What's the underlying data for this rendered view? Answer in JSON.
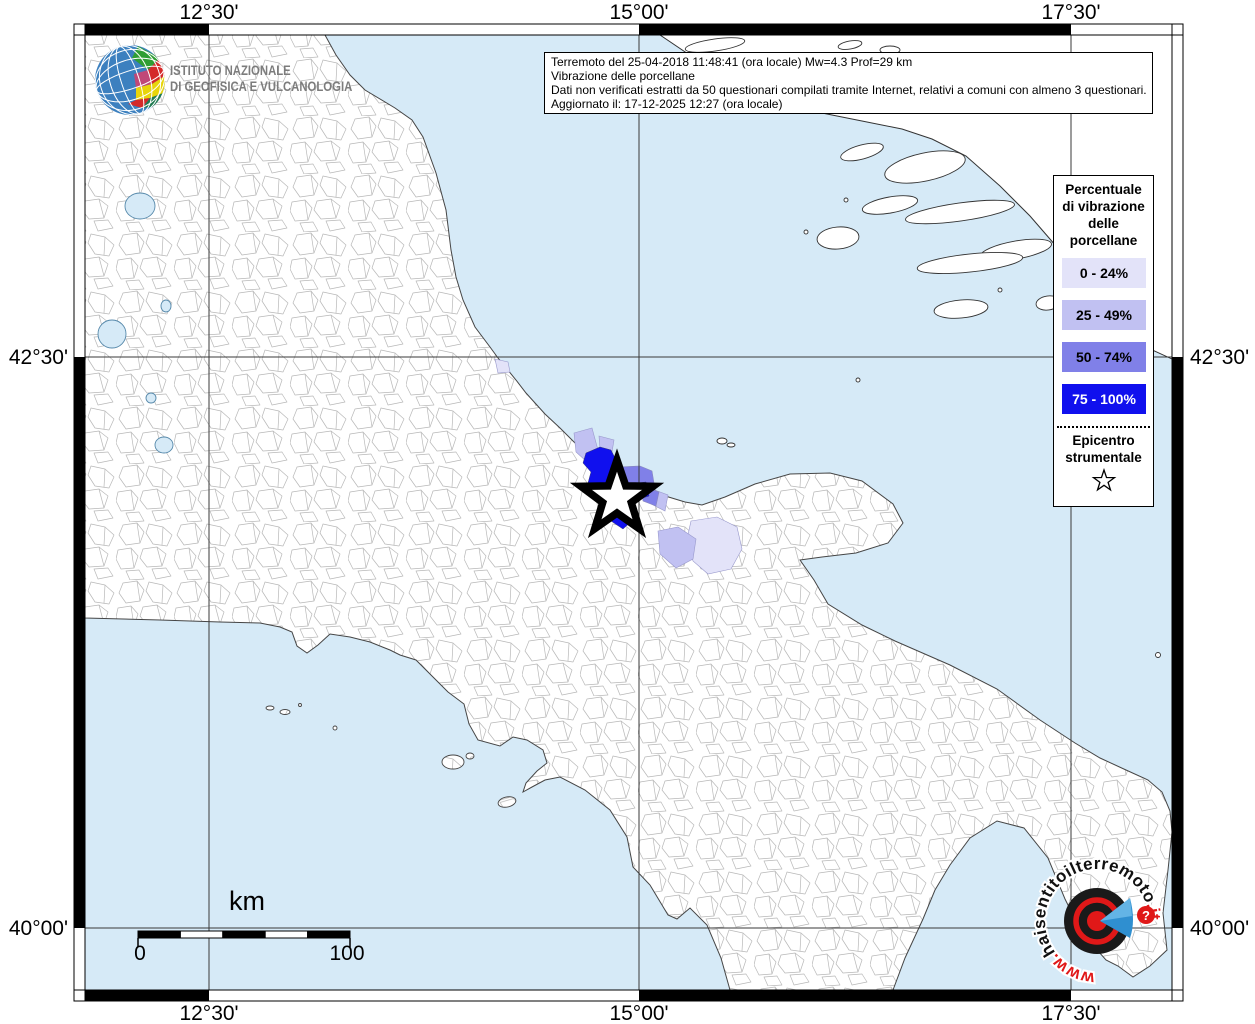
{
  "info_box": {
    "lines": [
      "Terremoto del 25-04-2018 11:48:41 (ora locale) Mw=4.3 Prof=29 km",
      "Vibrazione delle porcellane",
      "Dati non verificati estratti da 50 questionari compilati tramite Internet, relativi a comuni con almeno 3 questionari.",
      "Aggiornato il: 17-12-2025 12:27 (ora locale)"
    ]
  },
  "axis": {
    "top": [
      "12°30'",
      "15°00'",
      "17°30'"
    ],
    "bottom": [
      "12°30'",
      "15°00'",
      "17°30'"
    ],
    "left": [
      "42°30'",
      "40°00'"
    ],
    "right": [
      "42°30'",
      "40°00'"
    ]
  },
  "legend": {
    "title_lines": [
      "Percentuale",
      "di vibrazione",
      "delle",
      "porcellane"
    ],
    "classes": [
      {
        "label": "0 - 24%",
        "color": "#e3e3f9",
        "text_color": "#000000"
      },
      {
        "label": "25 - 49%",
        "color": "#c1c1f2",
        "text_color": "#000000"
      },
      {
        "label": "50 - 74%",
        "color": "#8080e8",
        "text_color": "#000000"
      },
      {
        "label": "75 - 100%",
        "color": "#1010ee",
        "text_color": "#ffffff"
      }
    ],
    "epicenter_lines": [
      "Epicentro",
      "strumentale"
    ]
  },
  "scale_bar": {
    "unit": "km",
    "min": "0",
    "max": "100"
  },
  "ingv_logo": {
    "line1": "ISTITUTO NAZIONALE",
    "line2": "DI GEOFISICA E VULCANOLOGIA"
  },
  "watermark": {
    "www": "www.",
    "site": "haisentitoilterremoto",
    "tld": ".it",
    "badge": "?"
  },
  "colors": {
    "sea": "#d6eaf7",
    "land": "#ffffff",
    "muni_border": "#b8b8b8",
    "coast": "#454545",
    "grid": "#3a3a3a",
    "logo_red": "#e01818",
    "logo_blue": "#2f8fd0",
    "star_fill": "#ffffff",
    "star_stroke": "#000000"
  }
}
